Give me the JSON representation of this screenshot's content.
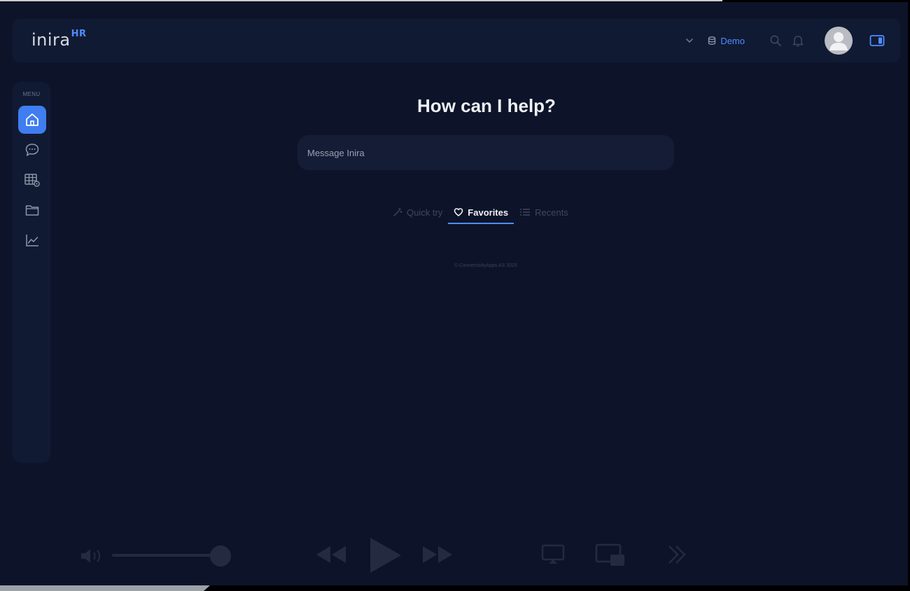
{
  "header": {
    "logo_text": "inira",
    "logo_sup": "HR",
    "workspace_label": "Demo"
  },
  "sidebar": {
    "menu_title": "MENU",
    "items": [
      {
        "name": "home",
        "active": true
      },
      {
        "name": "chat",
        "active": false
      },
      {
        "name": "tables",
        "active": false
      },
      {
        "name": "folder",
        "active": false
      },
      {
        "name": "analytics",
        "active": false
      }
    ]
  },
  "main": {
    "title": "How can I help?",
    "message_placeholder": "Message Inira",
    "tabs": [
      {
        "label": "Quick try",
        "icon": "wand-icon",
        "active": false
      },
      {
        "label": "Favorites",
        "icon": "heart-icon",
        "active": true
      },
      {
        "label": "Recents",
        "icon": "list-icon",
        "active": false
      }
    ],
    "copyright": "© ConnectivityApps AS 2025"
  },
  "colors": {
    "accent": "#4f8cff",
    "background": "#0d142a",
    "panel": "#111a33",
    "active_item": "#3f7df0"
  }
}
